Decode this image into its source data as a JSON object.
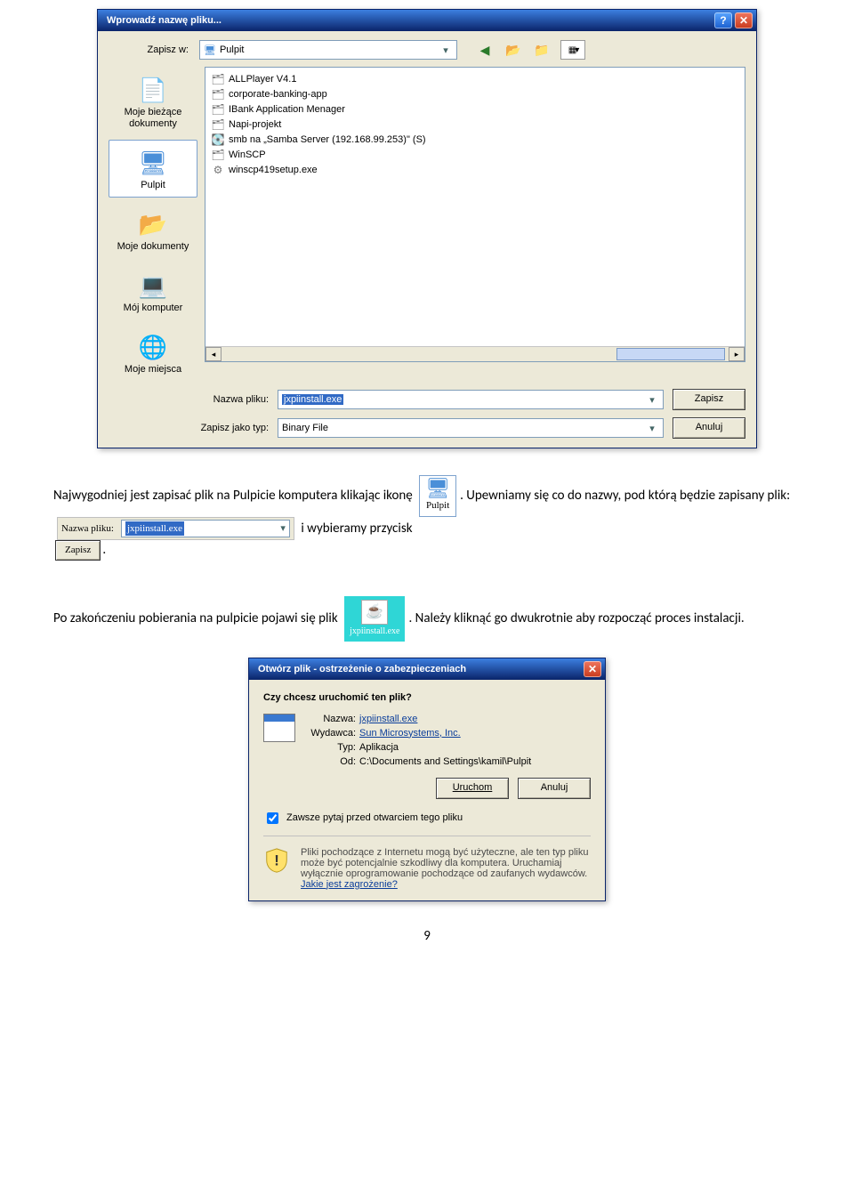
{
  "save_dialog": {
    "title": "Wprowadź nazwę pliku...",
    "save_in_label": "Zapisz w:",
    "save_in_value": "Pulpit",
    "places": [
      {
        "label": "Moje bieżące dokumenty"
      },
      {
        "label": "Pulpit"
      },
      {
        "label": "Moje dokumenty"
      },
      {
        "label": "Mój komputer"
      },
      {
        "label": "Moje miejsca"
      }
    ],
    "files": [
      "ALLPlayer V4.1",
      "corporate-banking-app",
      "IBank Application Menager",
      "Napi-projekt",
      "smb na „Samba Server (192.168.99.253)\" (S)",
      "WinSCP",
      "winscp419setup.exe"
    ],
    "filename_label": "Nazwa pliku:",
    "filename_value": "jxpiinstall.exe",
    "filetype_label": "Zapisz jako typ:",
    "filetype_value": "Binary File",
    "save_btn": "Zapisz",
    "cancel_btn": "Anuluj"
  },
  "narrative": {
    "p1a": "Najwygodniej jest zapisać plik na Pulpicie komputera klikając ikonę",
    "p1b": ". Upewniamy się co do nazwy, pod którą będzie zapisany plik:",
    "p1c": " i wybieramy przycisk ",
    "p1d": ".",
    "pulpit_chip": "Pulpit",
    "strip_label": "Nazwa pliku:",
    "strip_value": "jxpiinstall.exe",
    "zapisz_btn": "Zapisz",
    "p2a": "Po zakończeniu pobierania na pulpicie pojawi się plik",
    "p2b": ". Należy kliknąć go dwukrotnie aby rozpocząć proces instalacji.",
    "file_chip": "jxpiinstall.exe"
  },
  "sec_dialog": {
    "title": "Otwórz plik - ostrzeżenie o zabezpieczeniach",
    "question": "Czy chcesz uruchomić ten plik?",
    "name_k": "Nazwa:",
    "name_v": "jxpiinstall.exe",
    "pub_k": "Wydawca:",
    "pub_v": "Sun Microsystems, Inc.",
    "type_k": "Typ:",
    "type_v": "Aplikacja",
    "from_k": "Od:",
    "from_v": "C:\\Documents and Settings\\kamil\\Pulpit",
    "run_btn": "Uruchom",
    "cancel_btn": "Anuluj",
    "always_ask": "Zawsze pytaj przed otwarciem tego pliku",
    "warn_text": "Pliki pochodzące z Internetu mogą być użyteczne, ale ten typ pliku może być potencjalnie szkodliwy dla komputera. Uruchamiaj wyłącznie oprogramowanie pochodzące od zaufanych wydawców.",
    "warn_link": "Jakie jest zagrożenie?"
  },
  "page_number": "9"
}
